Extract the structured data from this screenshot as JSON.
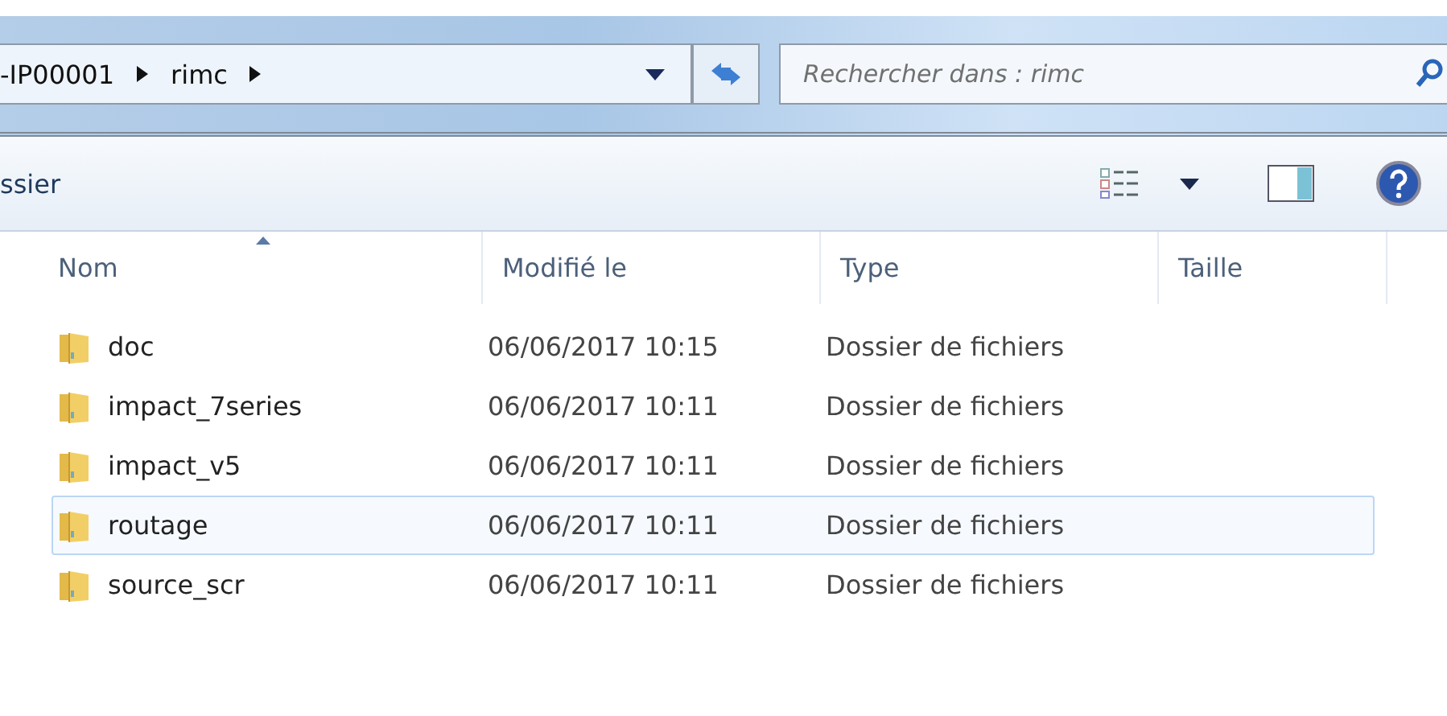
{
  "address_bar": {
    "breadcrumbs": [
      "-IP00001",
      "rimc"
    ]
  },
  "search": {
    "placeholder": "Rechercher dans : rimc"
  },
  "toolbar": {
    "label": "ssier"
  },
  "table": {
    "columns": [
      {
        "label": "Nom",
        "sorted": true
      },
      {
        "label": "Modifié le",
        "sorted": false
      },
      {
        "label": "Type",
        "sorted": false
      },
      {
        "label": "Taille",
        "sorted": false
      }
    ],
    "rows": [
      {
        "name": "doc",
        "modified": "06/06/2017 10:15",
        "type": "Dossier de fichiers",
        "selected": false
      },
      {
        "name": "impact_7series",
        "modified": "06/06/2017 10:11",
        "type": "Dossier de fichiers",
        "selected": false
      },
      {
        "name": "impact_v5",
        "modified": "06/06/2017 10:11",
        "type": "Dossier de fichiers",
        "selected": false
      },
      {
        "name": "routage",
        "modified": "06/06/2017 10:11",
        "type": "Dossier de fichiers",
        "selected": true
      },
      {
        "name": "source_scr",
        "modified": "06/06/2017 10:11",
        "type": "Dossier de fichiers",
        "selected": false
      }
    ]
  }
}
